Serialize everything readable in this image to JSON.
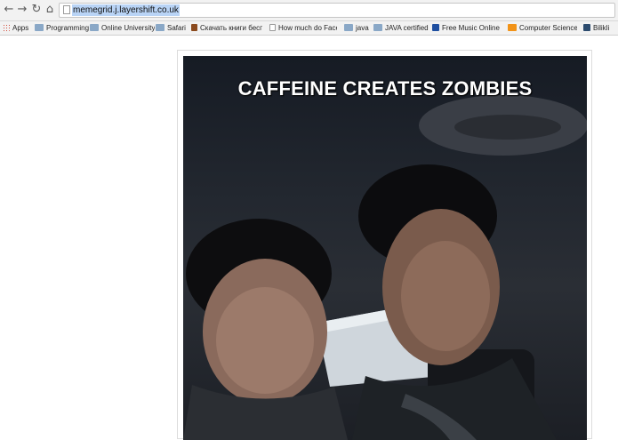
{
  "toolbar": {
    "back_icon": "back-arrow-icon",
    "forward_icon": "forward-arrow-icon",
    "reload_icon": "reload-icon",
    "home_icon": "home-icon",
    "url": "memegrid.j.layershift.co.uk"
  },
  "bookmarks": [
    {
      "label": "Apps",
      "icon": "apps-grid-icon"
    },
    {
      "label": "Programming",
      "icon": "folder-icon"
    },
    {
      "label": "Online University",
      "icon": "folder-icon"
    },
    {
      "label": "Safari",
      "icon": "folder-icon"
    },
    {
      "label": "Скачать книги бесп",
      "icon": "book-icon"
    },
    {
      "label": "How much do Faceb",
      "icon": "page-icon"
    },
    {
      "label": "java",
      "icon": "folder-icon"
    },
    {
      "label": "JAVA certified",
      "icon": "folder-icon"
    },
    {
      "label": "Free Music Online -",
      "icon": "facebook-icon"
    },
    {
      "label": "Computer Science, f",
      "icon": "orange-icon"
    },
    {
      "label": "Bilikli",
      "icon": "bilkli-icon"
    }
  ],
  "meme": {
    "caption": "CAFFEINE CREATES ZOMBIES"
  }
}
